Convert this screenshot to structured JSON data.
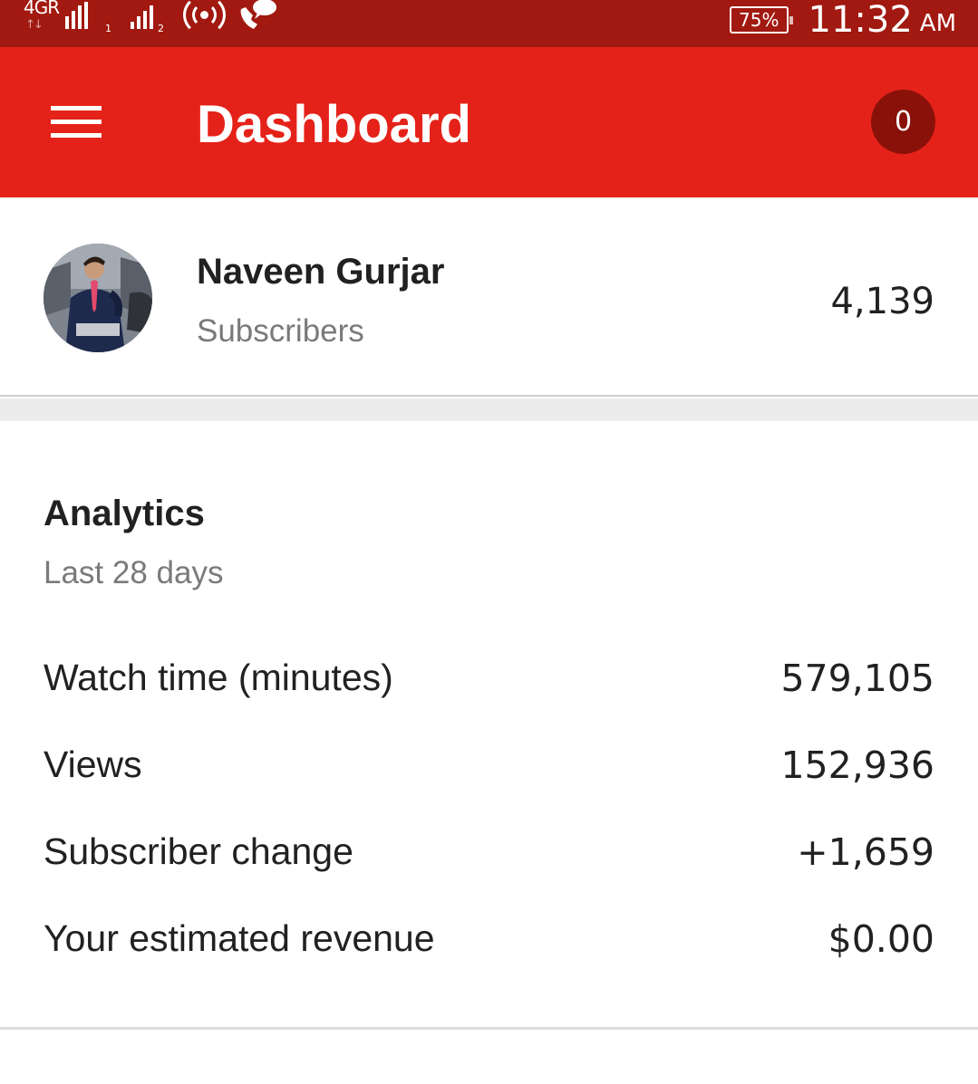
{
  "status_bar": {
    "network_type": "4G",
    "network_extra": "R",
    "sim1_index": "1",
    "sim2_index": "2",
    "battery": "75%",
    "time": "11:32",
    "ampm": "AM",
    "icons": [
      "signal-icon",
      "hotspot-icon",
      "wifi-calling-icon",
      "battery-icon"
    ]
  },
  "app_bar": {
    "title": "Dashboard",
    "notification_count": "0",
    "colors": {
      "app_bar": "#e52219",
      "status_bar": "#a11910",
      "badge": "#8a1109"
    }
  },
  "channel": {
    "name": "Naveen Gurjar",
    "subscribers_label": "Subscribers",
    "subscribers_count": "4,139"
  },
  "analytics": {
    "title": "Analytics",
    "period": "Last 28 days",
    "metrics": [
      {
        "label": "Watch time (minutes)",
        "value": "579,105"
      },
      {
        "label": "Views",
        "value": "152,936"
      },
      {
        "label": "Subscriber change",
        "value": "+1,659"
      },
      {
        "label": "Your estimated revenue",
        "value": "$0.00"
      }
    ]
  }
}
